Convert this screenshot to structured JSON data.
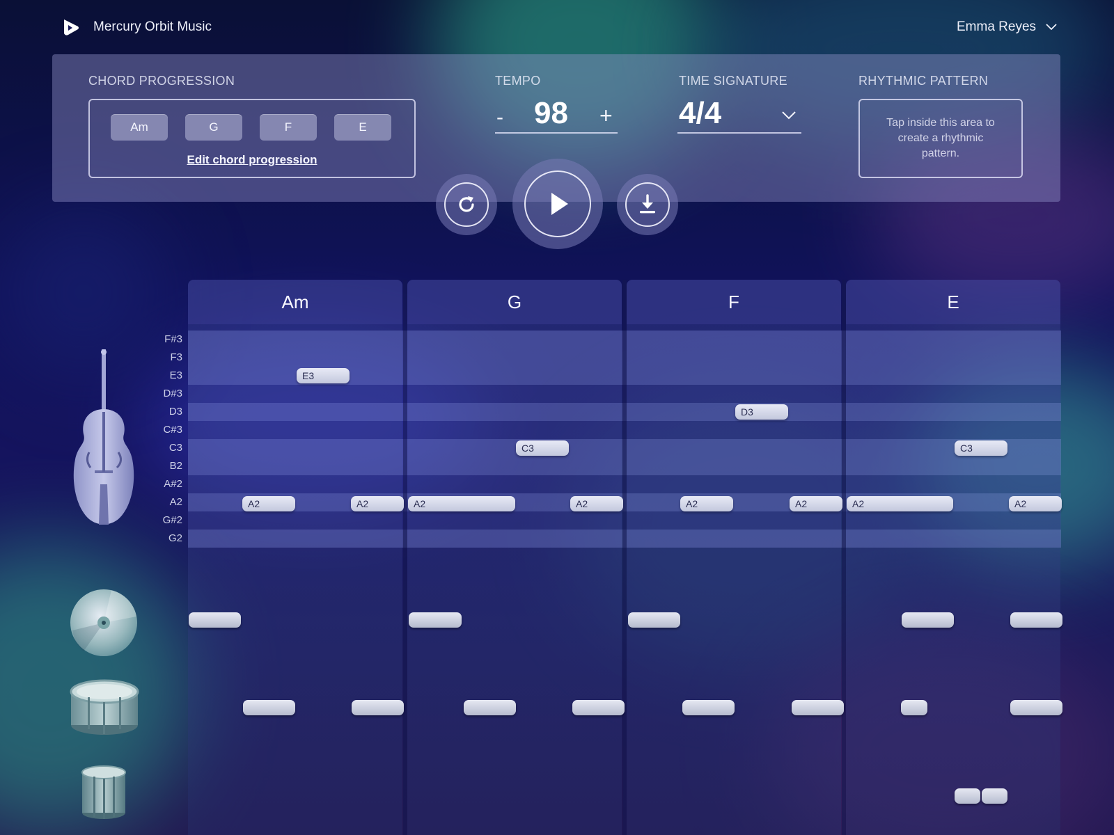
{
  "header": {
    "app_name": "Mercury Orbit Music",
    "user_name": "Emma Reyes"
  },
  "controls": {
    "chord_progression_label": "CHORD PROGRESSION",
    "chords": [
      "Am",
      "G",
      "F",
      "E"
    ],
    "edit_chords_link": "Edit chord progression",
    "tempo_label": "TEMPO",
    "tempo_minus": "-",
    "tempo_value": "98",
    "tempo_plus": "+",
    "time_signature_label": "TIME SIGNATURE",
    "time_signature_value": "4/4",
    "rhythmic_pattern_label": "RHYTHMIC PATTERN",
    "rhythmic_pattern_hint": "Tap inside this area to create a rhythmic pattern."
  },
  "transport": {
    "icons": [
      "replay-icon",
      "play-icon",
      "download-icon"
    ]
  },
  "grid": {
    "bars": [
      "Am",
      "G",
      "F",
      "E"
    ],
    "pitches": [
      "F#3",
      "F3",
      "E3",
      "D#3",
      "D3",
      "C#3",
      "C3",
      "B2",
      "A#2",
      "A2",
      "G#2",
      "G2"
    ],
    "bass_notes": [
      {
        "pitch": "E3",
        "bar": 0,
        "label": "E3"
      },
      {
        "pitch": "D3",
        "bar": 2,
        "label": "D3"
      },
      {
        "pitch": "C3",
        "bar": 1,
        "label": "C3"
      },
      {
        "pitch": "C3",
        "bar": 3,
        "label": "C3"
      },
      {
        "pitch": "A2",
        "bar": 0,
        "label": "A2"
      },
      {
        "pitch": "A2",
        "bar": 0,
        "label": "A2"
      },
      {
        "pitch": "A2",
        "bar": 1,
        "label": "A2"
      },
      {
        "pitch": "A2",
        "bar": 1,
        "label": "A2"
      },
      {
        "pitch": "A2",
        "bar": 2,
        "label": "A2"
      },
      {
        "pitch": "A2",
        "bar": 2,
        "label": "A2"
      },
      {
        "pitch": "A2",
        "bar": 3,
        "label": "A2"
      },
      {
        "pitch": "A2",
        "bar": 3,
        "label": "A2"
      }
    ]
  },
  "instruments": [
    "double-bass-icon",
    "cymbal-icon",
    "snare-drum-icon",
    "kick-drum-icon"
  ]
}
